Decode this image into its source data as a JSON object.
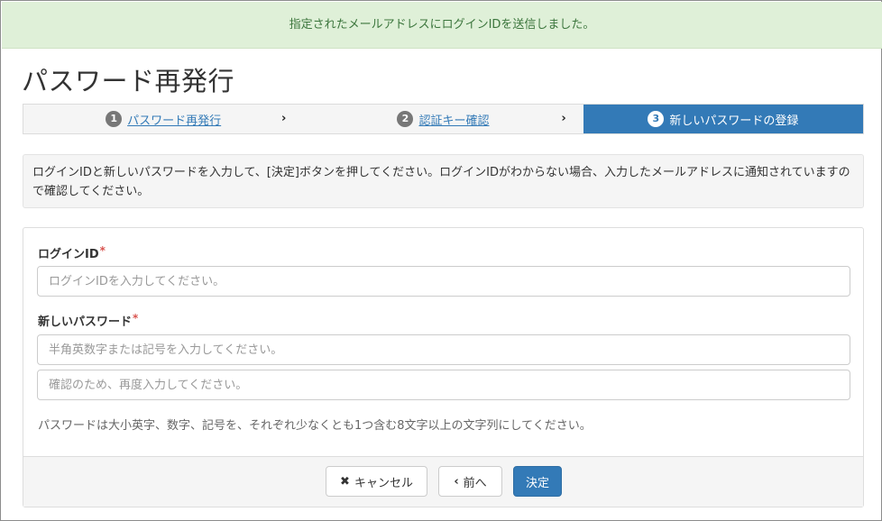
{
  "alert": {
    "message": "指定されたメールアドレスにログインIDを送信しました。"
  },
  "page": {
    "title": "パスワード再発行"
  },
  "steps": [
    {
      "num": "1",
      "label": "パスワード再発行"
    },
    {
      "num": "2",
      "label": "認証キー確認"
    },
    {
      "num": "3",
      "label": "新しいパスワードの登録"
    }
  ],
  "step_arrow": "›",
  "info": {
    "text": "ログインIDと新しいパスワードを入力して、[決定]ボタンを押してください。ログインIDがわからない場合、入力したメールアドレスに通知されていますので確認してください。"
  },
  "form": {
    "login_id_label": "ログインID",
    "login_id_placeholder": "ログインIDを入力してください。",
    "password_label": "新しいパスワード",
    "password_placeholder": "半角英数字または記号を入力してください。",
    "password_confirm_placeholder": "確認のため、再度入力してください。",
    "required_mark": "*",
    "help_text": "パスワードは大小英字、数字、記号を、それぞれ少なくとも1つ含む8文字以上の文字列にしてください。"
  },
  "buttons": {
    "cancel_icon": "✖",
    "cancel_label": "キャンセル",
    "prev_icon": "‹",
    "prev_label": "前へ",
    "submit_label": "決定"
  },
  "colors": {
    "alert_bg": "#dff0d8",
    "alert_text": "#3c763d",
    "primary": "#337ab7",
    "required": "#d9534f"
  }
}
